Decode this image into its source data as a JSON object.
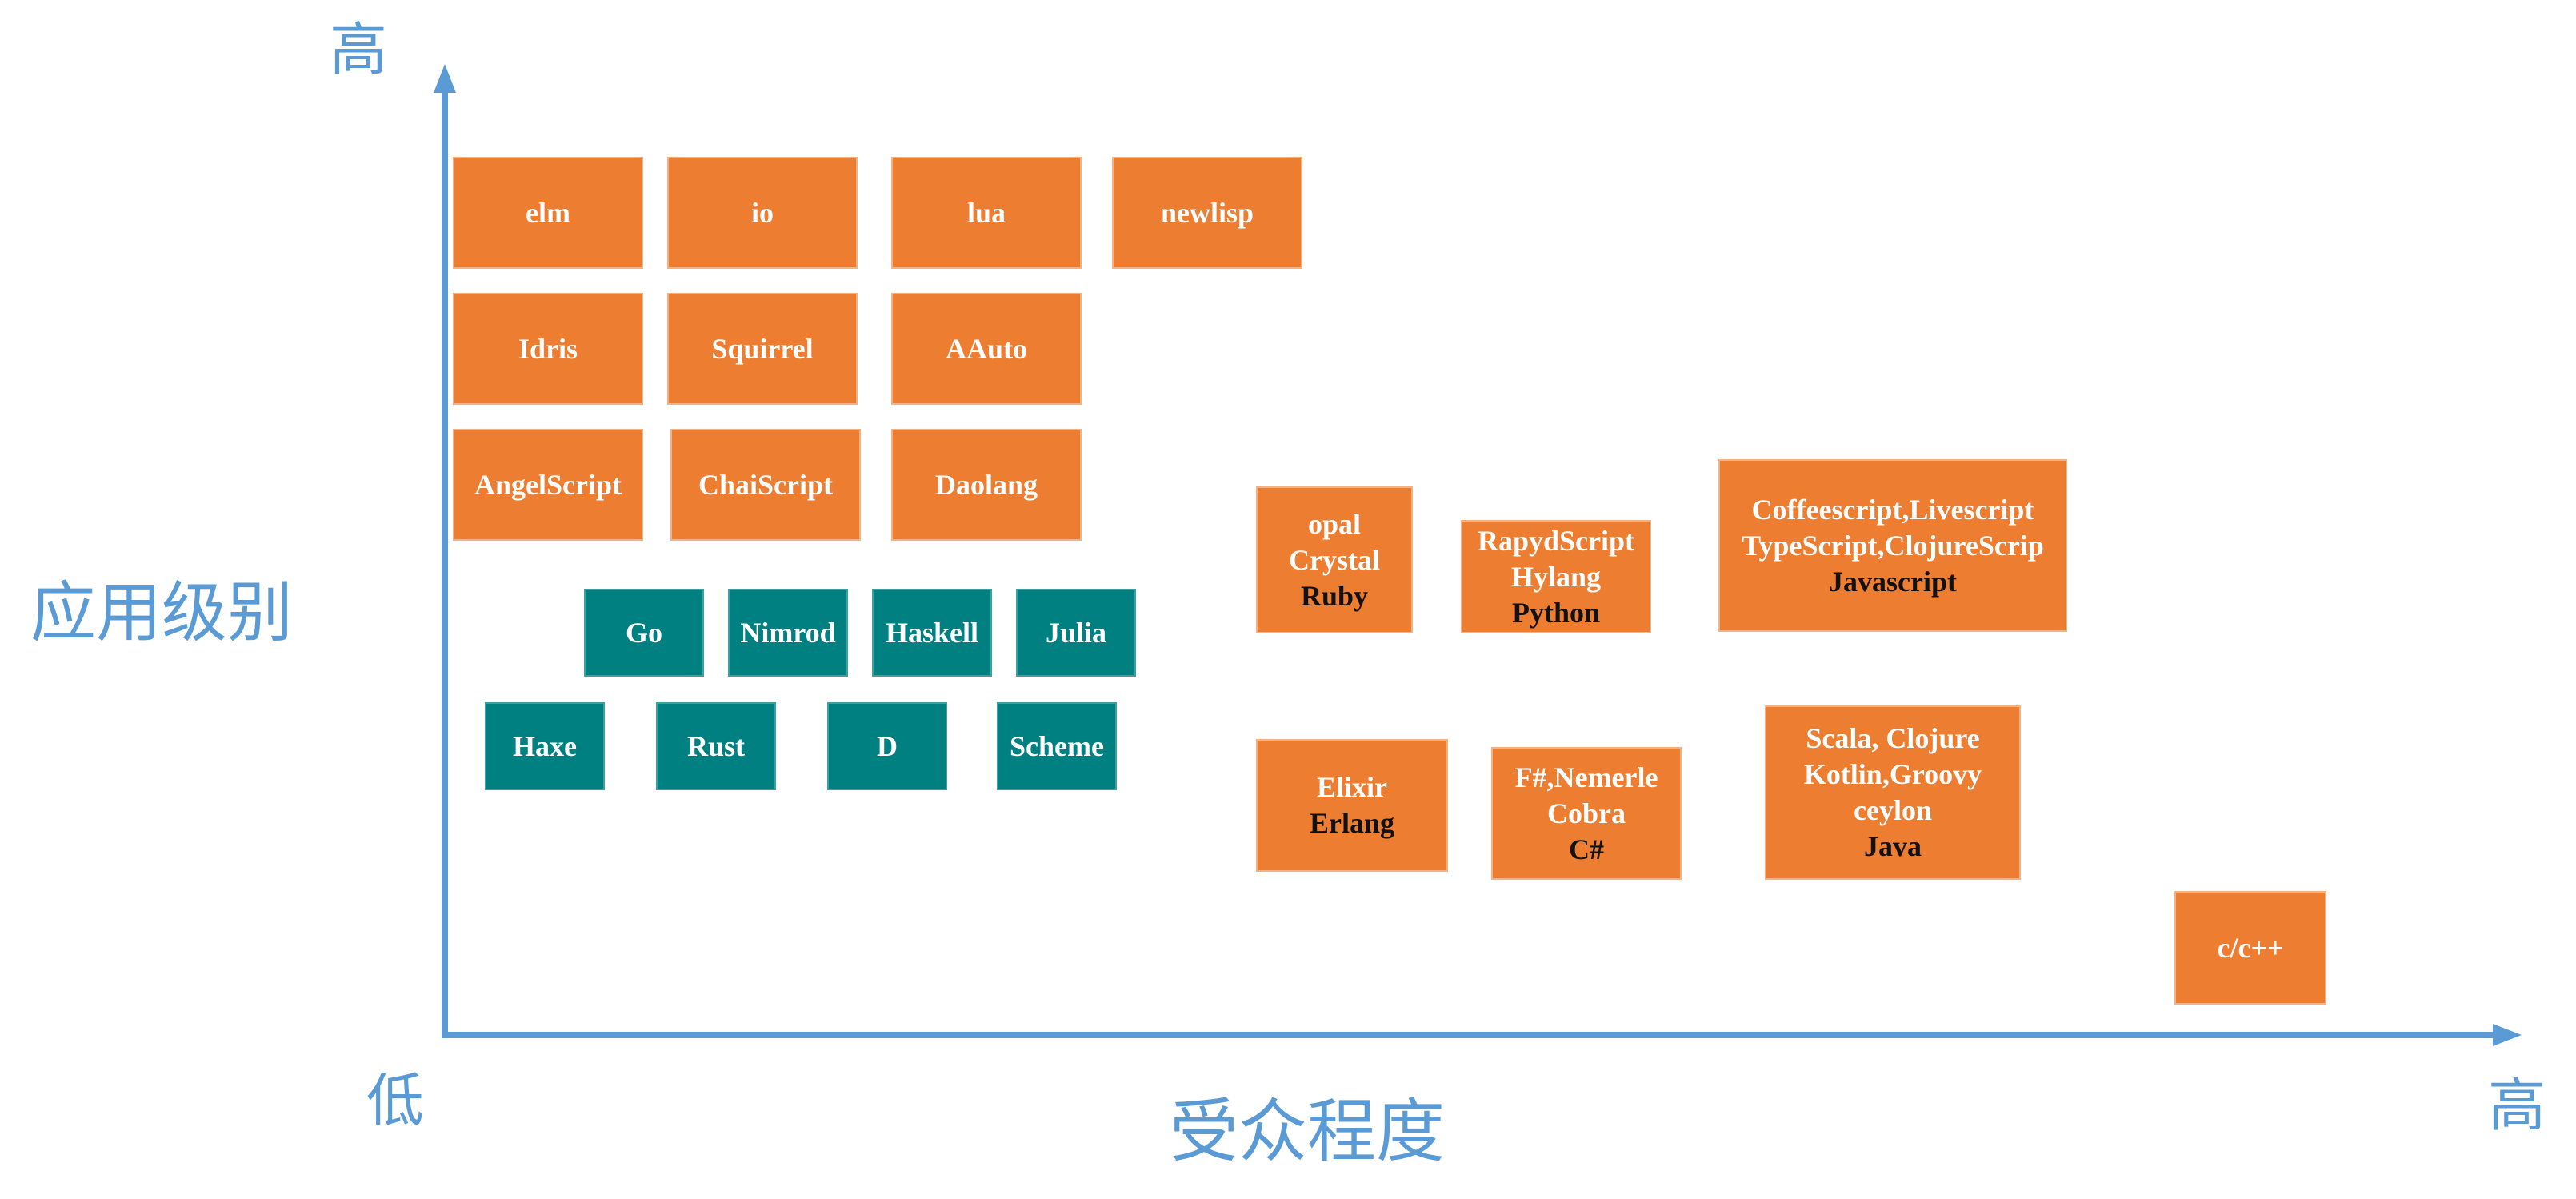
{
  "axes": {
    "y_high": "高",
    "y_title": "应用级别",
    "x_low": "低",
    "x_title": "受众程度",
    "x_high": "高",
    "color": "#5b9bd5"
  },
  "colors": {
    "orange": "#ed7d31",
    "teal": "#008080"
  },
  "boxes": {
    "elm": {
      "lines": [
        "elm"
      ]
    },
    "io": {
      "lines": [
        "io"
      ]
    },
    "lua": {
      "lines": [
        "lua"
      ]
    },
    "newlisp": {
      "lines": [
        "newlisp"
      ]
    },
    "idris": {
      "lines": [
        "Idris"
      ]
    },
    "squirrel": {
      "lines": [
        "Squirrel"
      ]
    },
    "aauto": {
      "lines": [
        "AAuto"
      ]
    },
    "angelscript": {
      "lines": [
        "AngelScript"
      ]
    },
    "chaiscript": {
      "lines": [
        "ChaiScript"
      ]
    },
    "daolang": {
      "lines": [
        "Daolang"
      ]
    },
    "go": {
      "lines": [
        "Go"
      ]
    },
    "nimrod": {
      "lines": [
        "Nimrod"
      ]
    },
    "haskell": {
      "lines": [
        "Haskell"
      ]
    },
    "julia": {
      "lines": [
        "Julia"
      ]
    },
    "haxe": {
      "lines": [
        "Haxe"
      ]
    },
    "rust": {
      "lines": [
        "Rust"
      ]
    },
    "d": {
      "lines": [
        "D"
      ]
    },
    "scheme": {
      "lines": [
        "Scheme"
      ]
    },
    "ruby": {
      "lines": [
        "opal",
        "Crystal",
        "Ruby"
      ]
    },
    "python": {
      "lines": [
        "RapydScript",
        "Hylang",
        "Python"
      ]
    },
    "javascript": {
      "lines": [
        "Coffeescript,Livescript",
        "TypeScript,ClojureScrip",
        "Javascript"
      ]
    },
    "erlang": {
      "lines": [
        "Elixir",
        "Erlang"
      ]
    },
    "csharp": {
      "lines": [
        "F#,Nemerle",
        "Cobra",
        "C#"
      ]
    },
    "java": {
      "lines": [
        "Scala, Clojure",
        "Kotlin,Groovy",
        "ceylon",
        "Java"
      ]
    },
    "cpp": {
      "lines": [
        "c/c++"
      ]
    }
  }
}
